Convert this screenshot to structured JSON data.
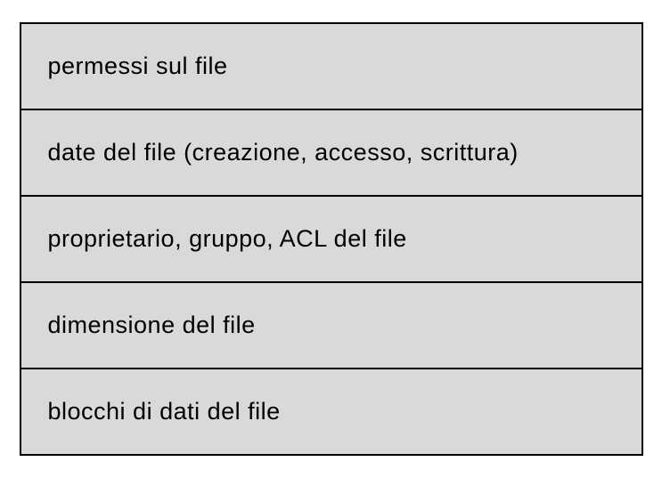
{
  "rows": [
    "permessi sul file",
    "date del file (creazione, accesso, scrittura)",
    "proprietario, gruppo, ACL del file",
    "dimensione del file",
    "blocchi di dati del file"
  ]
}
